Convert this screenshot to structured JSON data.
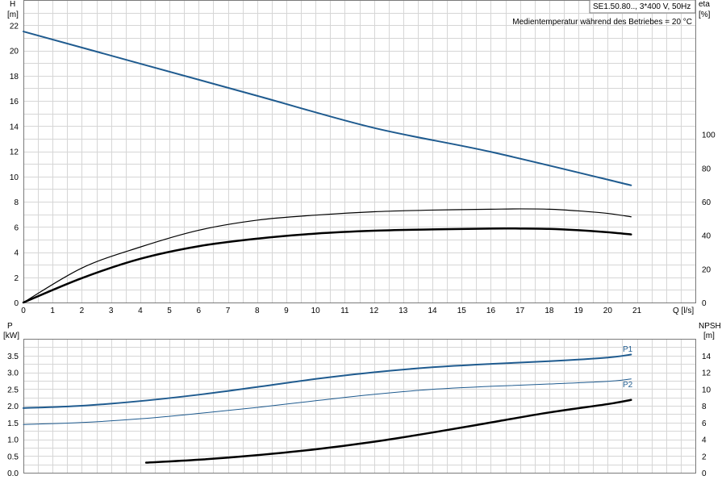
{
  "colors": {
    "blue": "#1f5b8f",
    "black": "#000000",
    "grid": "#d6d6d6"
  },
  "chart_data": [
    {
      "type": "line",
      "header_box": "SE1.50.80.., 3*400 V, 50Hz",
      "note": "Medientemperatur während des Betriebes = 20 °C",
      "left_axis": {
        "label": "H",
        "unit": "[m]",
        "ylim": [
          0,
          24
        ],
        "ticks": [
          0,
          2,
          4,
          6,
          8,
          10,
          12,
          14,
          16,
          18,
          20,
          22
        ]
      },
      "right_axis": {
        "label": "eta",
        "unit": "[%]",
        "ylim": [
          0,
          180
        ],
        "ticks": [
          0,
          20,
          40,
          60,
          80,
          100
        ]
      },
      "x_axis": {
        "label": "Q [l/s]",
        "xlim": [
          0,
          23
        ],
        "ticks": [
          0,
          1,
          2,
          3,
          4,
          5,
          6,
          7,
          8,
          9,
          10,
          11,
          12,
          13,
          14,
          15,
          16,
          17,
          18,
          19,
          20,
          21
        ]
      },
      "series": [
        {
          "axis": "left",
          "color": "blue",
          "width": 2,
          "points": [
            [
              0,
              21.5
            ],
            [
              4,
              18.95
            ],
            [
              8,
              16.4
            ],
            [
              12,
              13.85
            ],
            [
              16,
              11.95
            ],
            [
              20.8,
              9.3
            ]
          ]
        },
        {
          "axis": "right",
          "color": "black",
          "width": 1.2,
          "points": [
            [
              0,
              0
            ],
            [
              2,
              20.5
            ],
            [
              4,
              33
            ],
            [
              6,
              43
            ],
            [
              8,
              49
            ],
            [
              10,
              52
            ],
            [
              12,
              54
            ],
            [
              14,
              55
            ],
            [
              16,
              55.5
            ],
            [
              17,
              55.7
            ],
            [
              18,
              55.5
            ],
            [
              19,
              54.5
            ],
            [
              20,
              53
            ],
            [
              20.8,
              51
            ]
          ]
        },
        {
          "axis": "right",
          "color": "black",
          "width": 2.5,
          "points": [
            [
              0,
              0
            ],
            [
              2,
              14.5
            ],
            [
              4,
              26
            ],
            [
              6,
              33.5
            ],
            [
              8,
              38
            ],
            [
              10,
              41
            ],
            [
              12,
              42.7
            ],
            [
              14,
              43.5
            ],
            [
              16,
              44
            ],
            [
              17,
              44
            ],
            [
              18,
              43.8
            ],
            [
              19,
              43
            ],
            [
              20,
              41.8
            ],
            [
              20.8,
              40.5
            ]
          ]
        }
      ]
    },
    {
      "type": "line",
      "left_axis": {
        "label": "P",
        "unit": "[kW]",
        "ylim": [
          0,
          4.0
        ],
        "ticks": [
          0.0,
          0.5,
          1.0,
          1.5,
          2.0,
          2.5,
          3.0,
          3.5
        ]
      },
      "right_axis": {
        "label": "NPSH",
        "unit": "[m]",
        "ylim": [
          0,
          16
        ],
        "ticks": [
          0,
          2,
          4,
          6,
          8,
          10,
          12,
          14
        ]
      },
      "x_axis": {
        "xlim": [
          0,
          23
        ],
        "ticks": [
          0,
          1,
          2,
          3,
          4,
          5,
          6,
          7,
          8,
          9,
          10,
          11,
          12,
          13,
          14,
          15,
          16,
          17,
          18,
          19,
          20,
          21
        ]
      },
      "series": [
        {
          "name": "P1",
          "axis": "left",
          "color": "blue",
          "width": 2,
          "points": [
            [
              0,
              1.93
            ],
            [
              2,
              2.0
            ],
            [
              4,
              2.14
            ],
            [
              6,
              2.33
            ],
            [
              8,
              2.56
            ],
            [
              10,
              2.8
            ],
            [
              12,
              3.0
            ],
            [
              14,
              3.15
            ],
            [
              16,
              3.25
            ],
            [
              18,
              3.33
            ],
            [
              20,
              3.44
            ],
            [
              20.8,
              3.53
            ]
          ]
        },
        {
          "name": "P2",
          "axis": "left",
          "color": "blue",
          "width": 1,
          "points": [
            [
              0,
              1.44
            ],
            [
              2,
              1.5
            ],
            [
              4,
              1.61
            ],
            [
              6,
              1.77
            ],
            [
              8,
              1.95
            ],
            [
              10,
              2.15
            ],
            [
              12,
              2.34
            ],
            [
              14,
              2.49
            ],
            [
              16,
              2.58
            ],
            [
              18,
              2.65
            ],
            [
              20,
              2.73
            ],
            [
              20.8,
              2.8
            ]
          ]
        },
        {
          "axis": "right",
          "color": "black",
          "width": 2.5,
          "points": [
            [
              4.2,
              1.2
            ],
            [
              6,
              1.55
            ],
            [
              8,
              2.1
            ],
            [
              10,
              2.8
            ],
            [
              12,
              3.7
            ],
            [
              14,
              4.8
            ],
            [
              16,
              6.0
            ],
            [
              18,
              7.2
            ],
            [
              20,
              8.2
            ],
            [
              20.8,
              8.7
            ]
          ]
        }
      ]
    }
  ]
}
